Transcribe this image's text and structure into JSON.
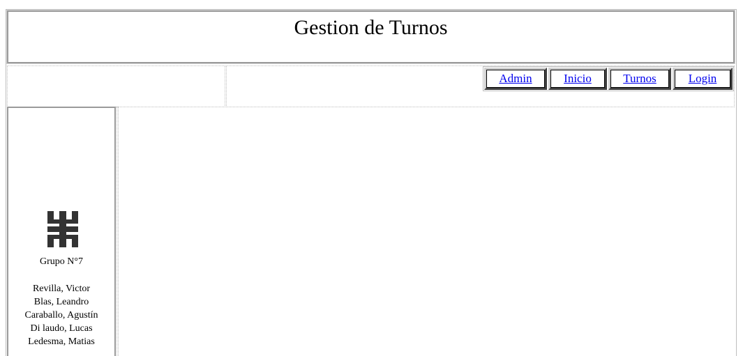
{
  "header": {
    "title": "Gestion de Turnos"
  },
  "nav": {
    "items": [
      {
        "label": "Admin"
      },
      {
        "label": "Inicio"
      },
      {
        "label": "Turnos"
      },
      {
        "label": "Login"
      }
    ]
  },
  "sidebar": {
    "logo_icon": "utn-logo-icon",
    "group": "Grupo N°7",
    "members": [
      "Revilla, Victor",
      "Blas, Leandro",
      "Caraballo, Agustín",
      "Di laudo, Lucas",
      "Ledesma, Matias"
    ]
  },
  "colors": {
    "link": "#0000ee",
    "logo": "#333333",
    "border": "#9a9a9a"
  }
}
